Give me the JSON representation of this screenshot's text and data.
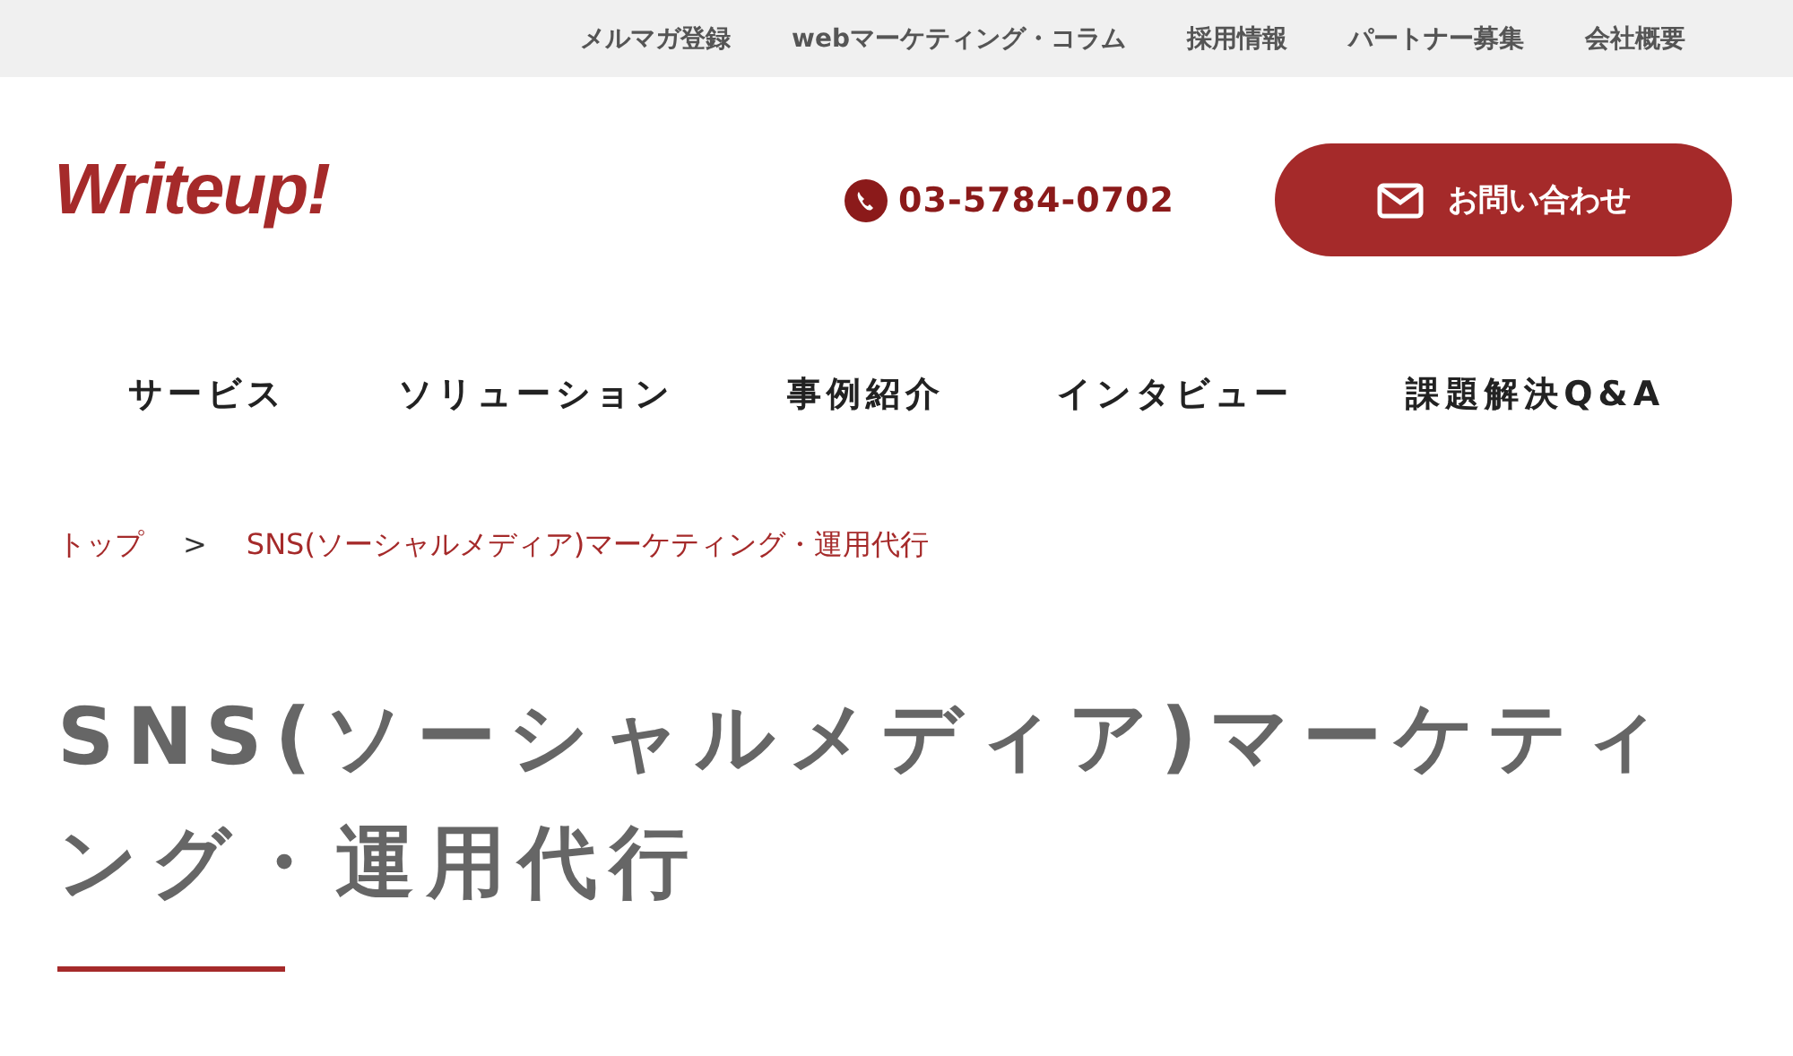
{
  "top_links": [
    "メルマガ登録",
    "webマーケティング・コラム",
    "採用情報",
    "パートナー募集",
    "会社概要"
  ],
  "header": {
    "logo": "Writeup!",
    "phone": "03-5784-0702",
    "contact_button": "お問い合わせ"
  },
  "nav": [
    "サービス",
    "ソリューション",
    "事例紹介",
    "インタビュー",
    "課題解決Q&A"
  ],
  "breadcrumb": [
    "トップ",
    "SNS(ソーシャルメディア)マーケティング・運用代行"
  ],
  "breadcrumb_separator": ">",
  "title": "SNS(ソーシャルメディア)マーケティング・運用代行"
}
